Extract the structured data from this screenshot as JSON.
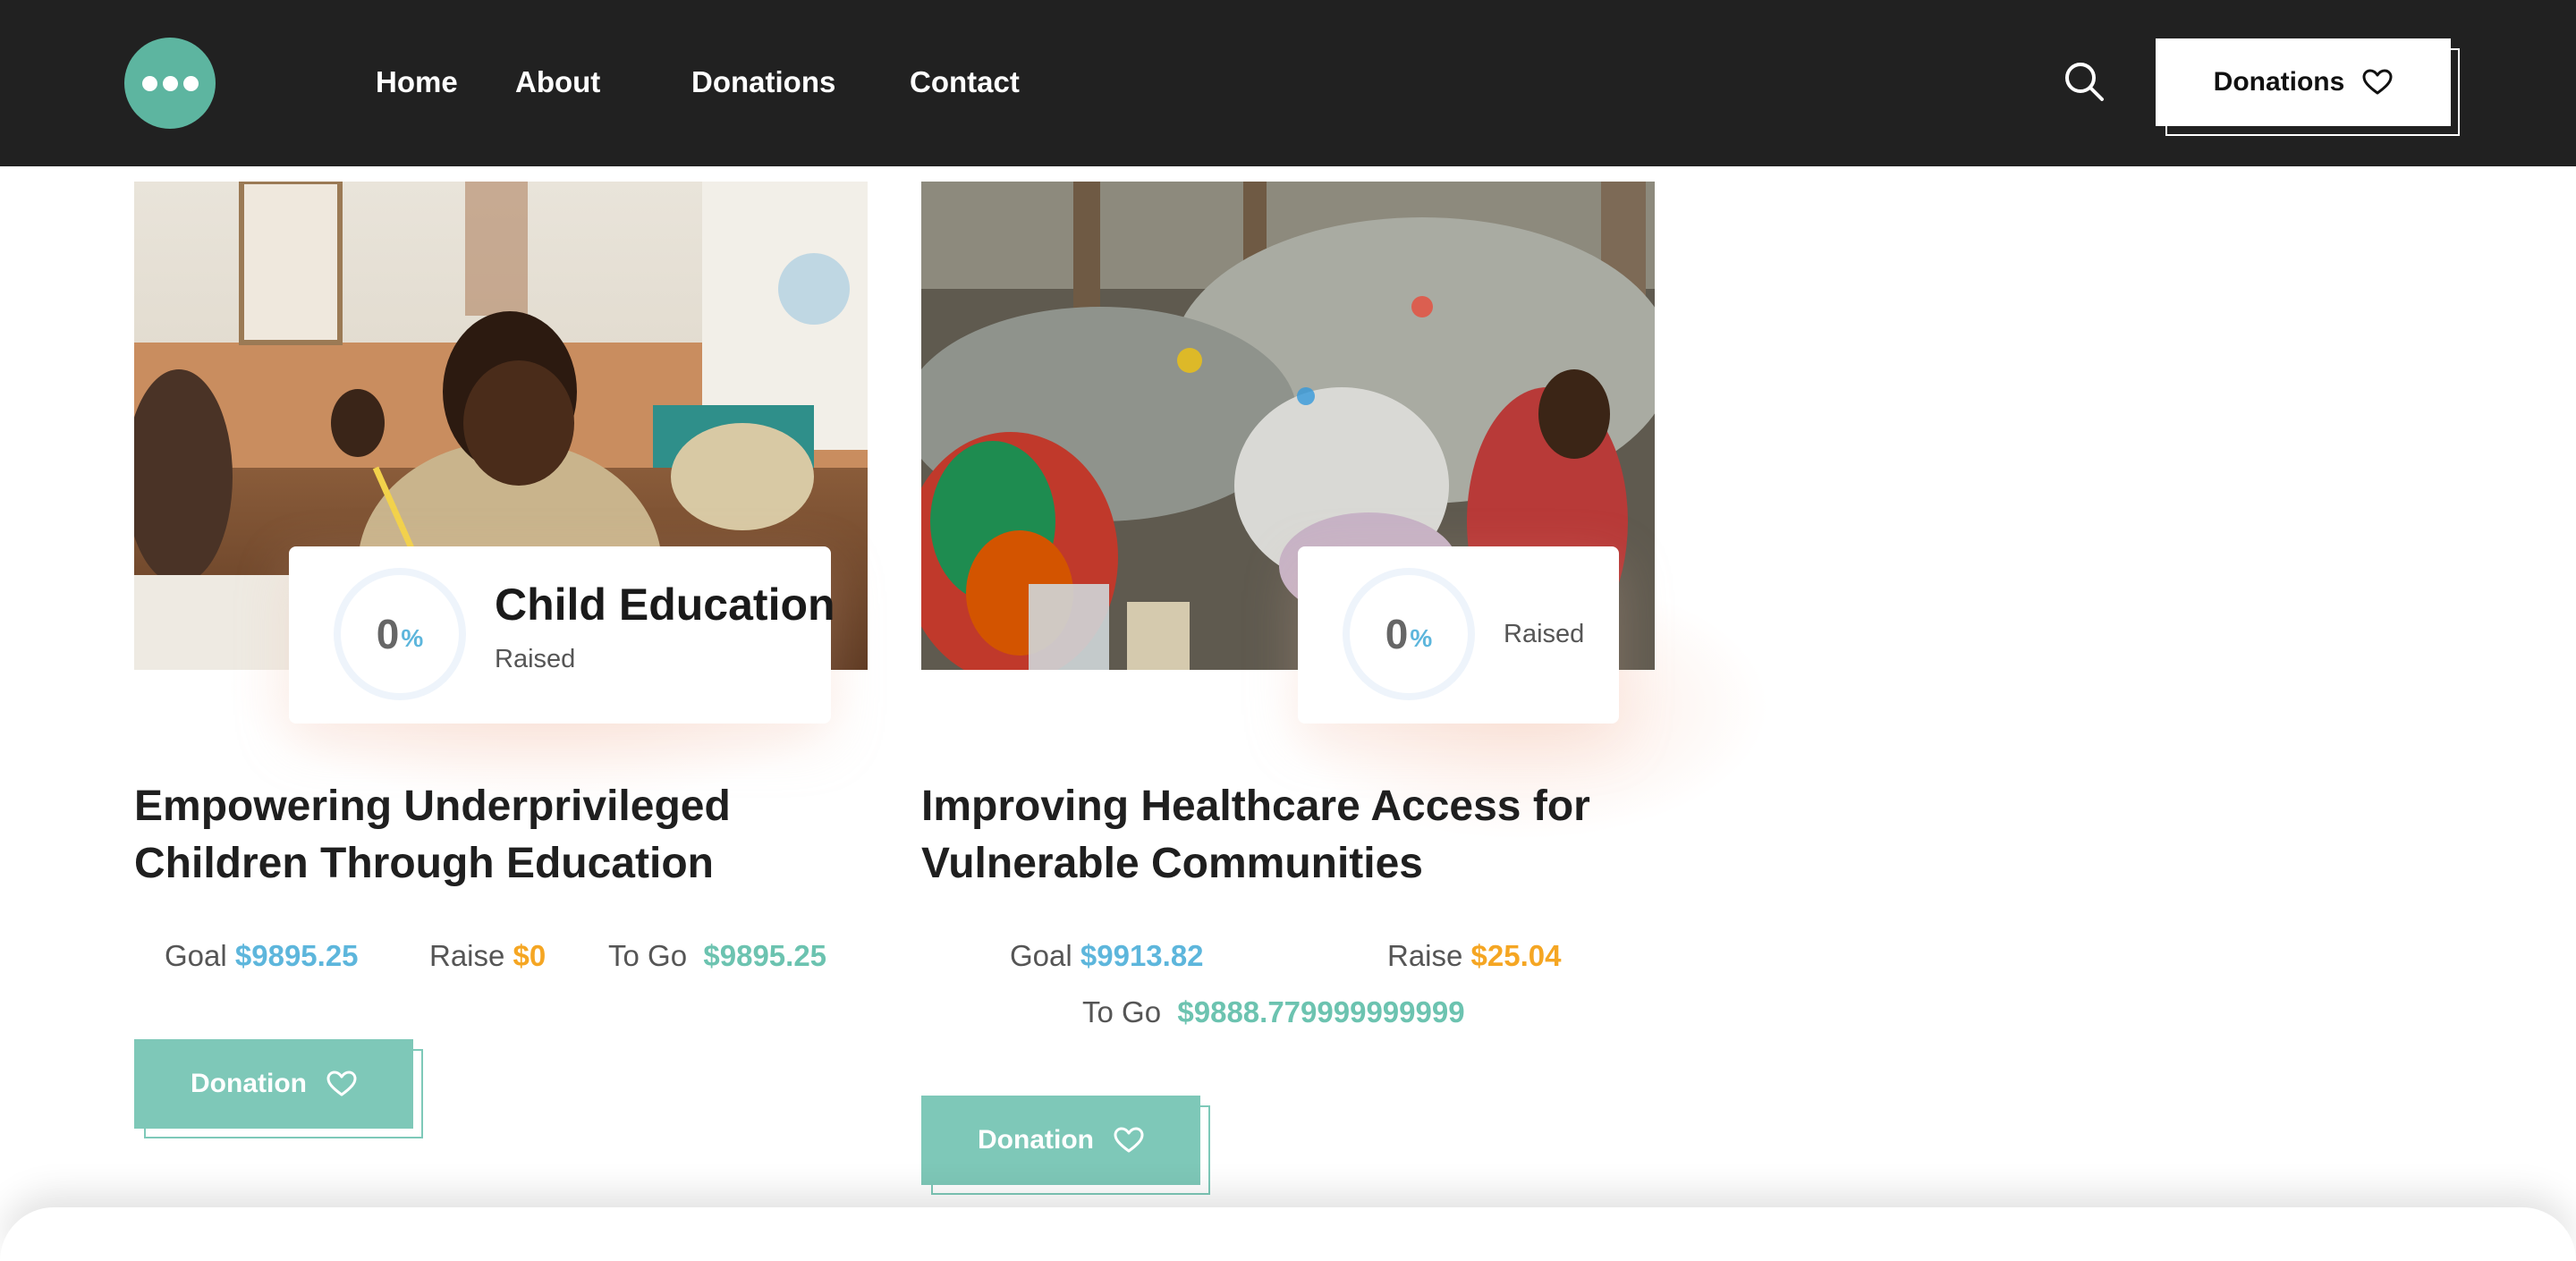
{
  "nav": {
    "links": [
      "Home",
      "About",
      "Donations",
      "Contact"
    ],
    "cta_label": "Donations"
  },
  "cards": [
    {
      "percent": "0",
      "percent_symbol": "%",
      "category": "Child Education",
      "raised_label": "Raised",
      "title": "Empowering Underprivileged Children Through Education",
      "goal_label": "Goal",
      "goal_value": "$9895.25",
      "raise_label": "Raise",
      "raise_value": "$0",
      "togo_label": "To Go",
      "togo_value": "$9895.25",
      "button_label": "Donation"
    },
    {
      "percent": "0",
      "percent_symbol": "%",
      "category": "",
      "raised_label": "Raised",
      "title": "Improving Healthcare Access for Vulnerable Communities",
      "goal_label": "Goal",
      "goal_value": "$9913.82",
      "raise_label": "Raise",
      "raise_value": "$25.04",
      "togo_label": "To Go",
      "togo_value": "$9888.779999999999",
      "button_label": "Donation"
    }
  ],
  "colors": {
    "brand": "#5db5a0",
    "goal": "#5db6dc",
    "raise": "#f5a623",
    "togo": "#6cc3b0",
    "navbar": "#212121"
  },
  "icons": [
    "logo-dots-icon",
    "search-icon",
    "heart-icon"
  ]
}
